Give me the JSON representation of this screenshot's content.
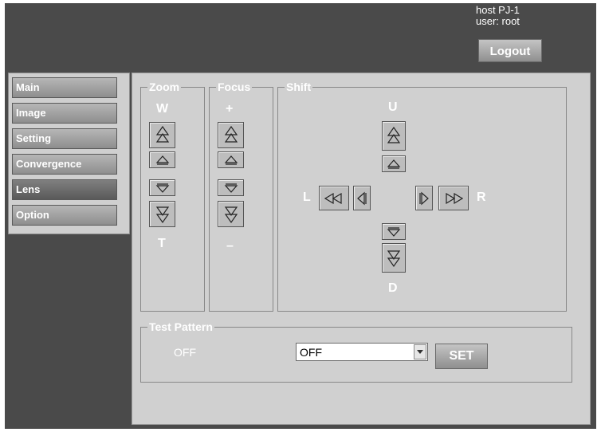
{
  "header": {
    "host_line": "host PJ-1",
    "user_line": "user: root",
    "logout_label": "Logout"
  },
  "sidebar": {
    "items": [
      {
        "label": "Main"
      },
      {
        "label": "Image"
      },
      {
        "label": "Setting"
      },
      {
        "label": "Convergence"
      },
      {
        "label": "Lens",
        "active": true
      },
      {
        "label": "Option"
      }
    ]
  },
  "lens": {
    "zoom": {
      "title": "Zoom",
      "top_label": "W",
      "bottom_label": "T"
    },
    "focus": {
      "title": "Focus",
      "top_label": "+",
      "bottom_label": "–"
    },
    "shift": {
      "title": "Shift",
      "up_label": "U",
      "down_label": "D",
      "left_label": "L",
      "right_label": "R"
    }
  },
  "test_pattern": {
    "title": "Test Pattern",
    "current_status": "OFF",
    "selected_option": "OFF",
    "set_label": "SET"
  },
  "icons": [
    "double-up-arrow-icon",
    "up-arrow-icon",
    "down-arrow-icon",
    "double-down-arrow-icon",
    "double-left-arrow-icon",
    "left-arrow-icon",
    "right-arrow-icon",
    "double-right-arrow-icon",
    "dropdown-arrow-icon"
  ],
  "colors": {
    "frame_bg": "#4a4a4a",
    "panel_bg": "#d0d0d0",
    "button_gray": "#a8a8a8",
    "active_tab": "#6a6a6a"
  }
}
